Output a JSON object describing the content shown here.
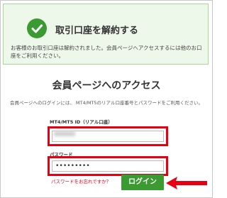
{
  "notice": {
    "title": "取引口座を解約する",
    "message": "お客様のお取引口座は解約されました。会員ページへアクセスするには他のお口座をご利用ください。",
    "icon": "check-circle-icon",
    "accent_color": "#3c9a32"
  },
  "login": {
    "title": "会員ページへのアクセス",
    "description": "会員ページへのログインには、 MT4/MT5のリアル口座番号とパスワードをご利用ください。",
    "account_label": "MT4/MT5 ID（リアル口座）",
    "account_value": "",
    "password_label": "パスワード",
    "password_value": "•••••••••",
    "forgot_link": "パスワードをお忘れですか？",
    "submit_label": "ログイン",
    "highlight_color": "#e60012"
  }
}
